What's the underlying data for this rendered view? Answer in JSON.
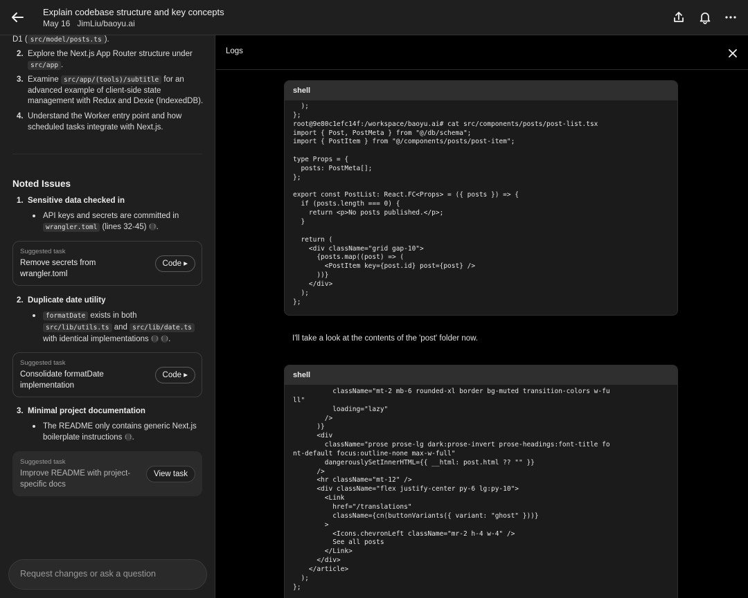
{
  "header": {
    "title": "Explain codebase structure and key concepts",
    "date": "May 16",
    "repo": "JimLiu/baoyu.ai"
  },
  "left": {
    "cutoff_prefix": "D1 (",
    "cutoff_code": "src/model/posts.ts",
    "cutoff_suffix": ").",
    "steps": [
      {
        "n": "2.",
        "pre": "Explore the Next.js App Router structure under ",
        "code": "src/app",
        "post": "."
      },
      {
        "n": "3.",
        "pre": "Examine ",
        "code": "src/app/(tools)/subtitle",
        "post": " for an advanced example of client-side state management with Redux and Dexie (IndexedDB)."
      },
      {
        "n": "4.",
        "pre": "Understand the Worker entry point and how scheduled tasks integrate with Next.js.",
        "code": "",
        "post": ""
      }
    ],
    "noted_title": "Noted Issues",
    "issues": [
      {
        "n": "1.",
        "title": "Sensitive data checked in"
      },
      {
        "n": "2.",
        "title": "Duplicate date utility"
      },
      {
        "n": "3.",
        "title": "Minimal project documentation"
      }
    ],
    "bullet1": {
      "a": "API keys and secrets are committed in ",
      "code": "wrangler.toml",
      "b": " (lines 32-45) ",
      "c": "."
    },
    "bullet2": {
      "code1": "formatDate",
      "a": " exists in both ",
      "code2": "src/lib/utils.ts",
      "b": " and ",
      "code3": "src/lib/date.ts",
      "c": " with identical implementations ",
      "d": "."
    },
    "bullet3": {
      "a": "The README only contains generic Next.js boilerplate instructions ",
      "b": "."
    },
    "cite_glyph": "{ }",
    "tasks": [
      {
        "label": "Suggested task",
        "title": "Remove secrets from wrangler.toml",
        "button": "Code ▸"
      },
      {
        "label": "Suggested task",
        "title": "Consolidate formatDate implementation",
        "button": "Code ▸"
      },
      {
        "label": "Suggested task",
        "title": "Improve README with project-specific docs",
        "button": "View task"
      }
    ],
    "request_placeholder": "Request changes or ask a question"
  },
  "right": {
    "title": "Logs",
    "shell1": {
      "label": "shell",
      "code": "  );\n};\nroot@9e80c1efc14f:/workspace/baoyu.ai# cat src/components/posts/post-list.tsx\nimport { Post, PostMeta } from \"@/db/schema\";\nimport { PostItem } from \"@/components/posts/post-item\";\n\ntype Props = {\n  posts: PostMeta[];\n};\n\nexport const PostList: React.FC<Props> = ({ posts }) => {\n  if (posts.length === 0) {\n    return <p>No posts published.</p>;\n  }\n\n  return (\n    <div className=\"grid gap-10\">\n      {posts.map((post) => (\n        <PostItem key={post.id} post={post} />\n      ))}\n    </div>\n  );\n};"
    },
    "message": "I'll take a look at the contents of the 'post' folder now.",
    "shell2": {
      "label": "shell",
      "code": "          className=\"mt-2 mb-6 rounded-xl border bg-muted transition-colors w-fu\nll\"\n          loading=\"lazy\"\n        />\n      )}\n      <div\n        className=\"prose prose-lg dark:prose-invert prose-headings:font-title fo\nnt-default focus:outline-none max-w-full\"\n        dangerouslySetInnerHTML={{ __html: post.html ?? \"\" }}\n      />\n      <hr className=\"mt-12\" />\n      <div className=\"flex justify-center py-6 lg:py-10\">\n        <Link\n          href=\"/translations\"\n          className={cn(buttonVariants({ variant: \"ghost\" }))}\n        >\n          <Icons.chevronLeft className=\"mr-2 h-4 w-4\" />\n          See all posts\n        </Link>\n      </div>\n    </article>\n  );\n};"
    }
  }
}
